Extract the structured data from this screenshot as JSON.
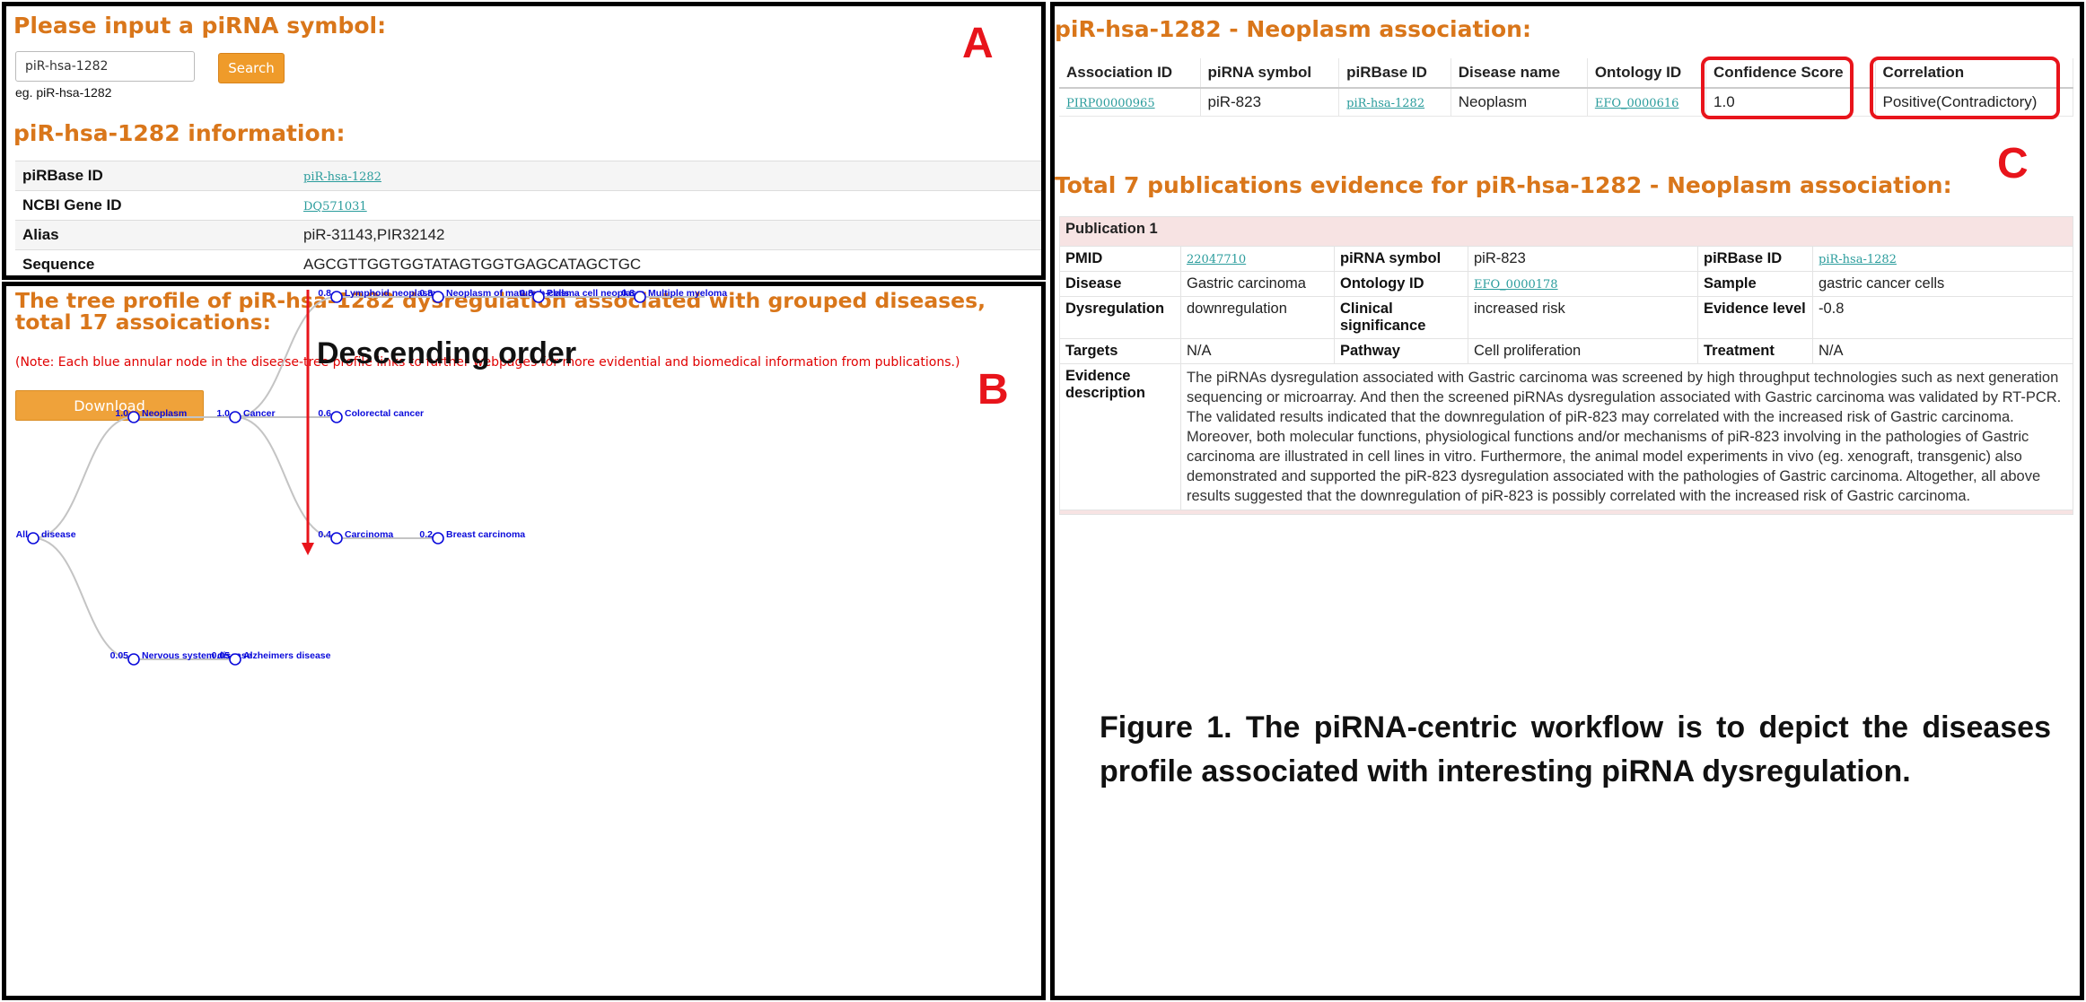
{
  "panel_a": {
    "letter": "A",
    "search_title": "Please input a piRNA symbol:",
    "search_value": "piR-hsa-1282",
    "search_button": "Search",
    "example": "eg. piR-hsa-1282",
    "info_title": "piR-hsa-1282 information:",
    "info_rows": [
      {
        "key": "piRBase ID",
        "value": "piR-hsa-1282"
      },
      {
        "key": "NCBI Gene ID",
        "value": "DQ571031"
      },
      {
        "key": "Alias",
        "value": "piR-31143,PIR32142"
      },
      {
        "key": "Sequence",
        "value": "AGCGTTGGTGGTATAGTGGTGAGCATAGCTGC"
      }
    ]
  },
  "panel_b": {
    "letter": "B",
    "title": "The tree profile of piR-hsa-1282 dysregulation associated with grouped diseases, total 17 assoications:",
    "note": "(Note: Each blue annular node in the disease-tree profile links to further webpages for more evidential and biomedical information from publications.)",
    "download_button": "Download",
    "arrow_label": "Descending order",
    "arrow_color": "#e8141b",
    "node_color": "#0a0adb",
    "nodes": [
      {
        "id": "all",
        "score": "All",
        "label": "disease"
      },
      {
        "id": "neoplasm",
        "score": "1.0",
        "label": "Neoplasm"
      },
      {
        "id": "nervous",
        "score": "0.05",
        "label": "Nervous system disease"
      },
      {
        "id": "cancer",
        "score": "1.0",
        "label": "Cancer"
      },
      {
        "id": "alzheimers",
        "score": "0.05",
        "label": "Alzheimers disease"
      },
      {
        "id": "lymphoid",
        "score": "0.8",
        "label": "Lymphoid neoplasm"
      },
      {
        "id": "colorectal",
        "score": "0.6",
        "label": "Colorectal cancer"
      },
      {
        "id": "carcinoma",
        "score": "0.4",
        "label": "Carcinoma"
      },
      {
        "id": "mature_b",
        "score": "0.8",
        "label": "Neoplasm of mature b-cells"
      },
      {
        "id": "plasma",
        "score": "0.8",
        "label": "Plasma cell neoplasm"
      },
      {
        "id": "myeloma",
        "score": "0.8",
        "label": "Multiple myeloma"
      },
      {
        "id": "breast",
        "score": "0.2",
        "label": "Breast carcinoma"
      }
    ]
  },
  "panel_c": {
    "letter": "C",
    "assoc_title": "piR-hsa-1282 - Neoplasm association:",
    "assoc_headers": [
      "Association ID",
      "piRNA symbol",
      "piRBase ID",
      "Disease name",
      "Ontology ID",
      "Confidence Score",
      "Correlation"
    ],
    "assoc_row": {
      "association_id": "PIRP00000965",
      "pirna_symbol": "piR-823",
      "pirbase_id": "piR-hsa-1282",
      "disease_name": "Neoplasm",
      "ontology_id": "EFO_0000616",
      "confidence_score": "1.0",
      "correlation": "Positive(Contradictory)"
    },
    "pub_title": "Total 7 publications evidence for piR-hsa-1282 - Neoplasm association:",
    "publication": {
      "header": "Publication 1",
      "pmid_label": "PMID",
      "pmid": "22047710",
      "pirna_label": "piRNA symbol",
      "pirna": "piR-823",
      "pirbase_label": "piRBase ID",
      "pirbase": "piR-hsa-1282",
      "disease_label": "Disease",
      "disease": "Gastric carcinoma",
      "ontology_label": "Ontology ID",
      "ontology": "EFO_0000178",
      "sample_label": "Sample",
      "sample": "gastric cancer cells",
      "dysreg_label": "Dysregulation",
      "dysreg": "downregulation",
      "clinical_label": "Clinical significance",
      "clinical": "increased risk",
      "evidence_label": "Evidence level",
      "evidence": "-0.8",
      "targets_label": "Targets",
      "targets": "N/A",
      "pathway_label": "Pathway",
      "pathway": "Cell proliferation",
      "treatment_label": "Treatment",
      "treatment": "N/A",
      "desc_label": "Evidence description",
      "desc": "The piRNAs dysregulation associated with Gastric carcinoma was screened by high throughput technologies such as next generation sequencing or microarray. And then the screened piRNAs dysregulation associated with Gastric carcinoma was validated by RT-PCR. The validated results indicated that the downregulation of piR-823 may correlated with the increased risk of Gastric carcinoma. Moreover, both molecular functions, physiological functions and/or mechanisms of piR-823 involving in the pathologies of Gastric carcinoma are illustrated in cell lines in vitro. Furthermore, the animal model experiments in vivo (eg. xenograft, transgenic) also demonstrated and supported the piR-823 dysregulation associated with the pathologies of Gastric carcinoma. Altogether, all above results suggested that the downregulation of piR-823 is possibly correlated with the increased risk of Gastric carcinoma."
    },
    "caption": "Figure 1. The piRNA-centric workflow is to depict the diseases profile associated with interesting piRNA dysregulation."
  }
}
